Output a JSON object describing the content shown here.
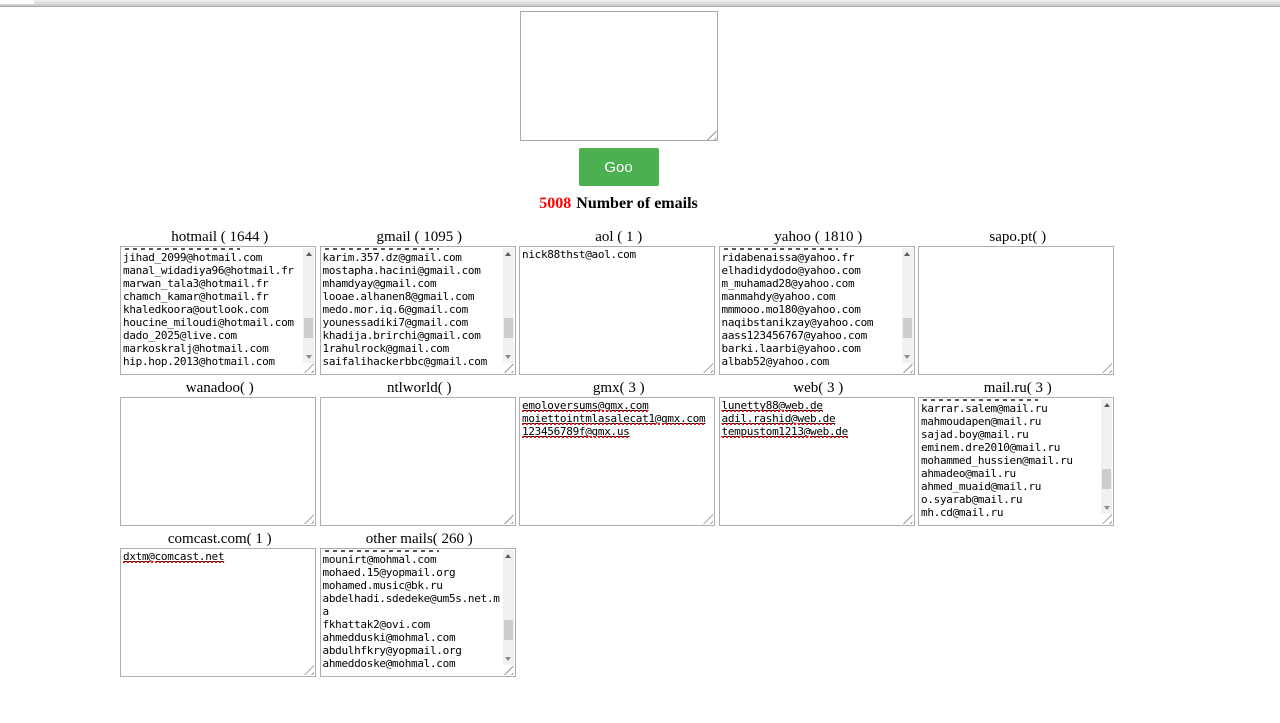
{
  "top": {
    "input_value": "",
    "button_label": "Goo",
    "count": "5008",
    "count_label": "Number of emails",
    "accent_color": "#4caf50",
    "count_color": "#ff0000"
  },
  "groups": [
    {
      "title": "hotmail ( 1644 )",
      "scrolled": true,
      "underlined": false,
      "emails": [
        "jihad_2099@hotmail.com",
        "manal_widadiya96@hotmail.fr",
        "marwan_tala3@hotmail.fr",
        "chamch_kamar@hotmail.fr",
        "khaledkoora@outlook.com",
        "houcine_miloudi@hotmail.com",
        "dado_2025@live.com",
        "markoskralj@hotmail.com",
        "hip.hop.2013@hotmail.com"
      ]
    },
    {
      "title": "gmail ( 1095 )",
      "scrolled": true,
      "underlined": false,
      "emails": [
        "karim.357.dz@gmail.com",
        "mostapha.hacini@gmail.com",
        "mhamdyay@gmail.com",
        "looae.alhanen8@gmail.com",
        "medo.mor.iq.6@gmail.com",
        "younessadiki7@gmail.com",
        "khadija.brirchi@gmail.com",
        "1rahulrock@gmail.com",
        "saifalihackerbbc@gmail.com"
      ]
    },
    {
      "title": "aol ( 1 )",
      "scrolled": false,
      "underlined": false,
      "emails": [
        "nick88thst@aol.com"
      ]
    },
    {
      "title": "yahoo ( 1810 )",
      "scrolled": true,
      "underlined": false,
      "emails": [
        "ridabenaissa@yahoo.fr",
        "elhadidydodo@yahoo.com",
        "m_muhamad28@yahoo.com",
        "manmahdy@yahoo.com",
        "mmmooo.mo180@yahoo.com",
        "naqibstanikzay@yahoo.com",
        "aass123456767@yahoo.com",
        "barki.laarbi@yahoo.com",
        "albab52@yahoo.com"
      ]
    },
    {
      "title": "sapo.pt( )",
      "scrolled": false,
      "underlined": false,
      "emails": []
    },
    {
      "title": "wanadoo( )",
      "scrolled": false,
      "underlined": false,
      "emails": []
    },
    {
      "title": "ntlworld( )",
      "scrolled": false,
      "underlined": false,
      "emails": []
    },
    {
      "title": "gmx( 3 )",
      "scrolled": false,
      "underlined": true,
      "emails": [
        "emoloversums@gmx.com",
        "moiettointmlasalecat1@gmx.com",
        "123456789f@gmx.us"
      ]
    },
    {
      "title": "web( 3 )",
      "scrolled": false,
      "underlined": true,
      "emails": [
        "lunetty88@web.de",
        "adil.rashid@web.de",
        "tempustom1213@web.de"
      ]
    },
    {
      "title": "mail.ru( 3 )",
      "scrolled": true,
      "underlined": false,
      "emails": [
        "karrar.salem@mail.ru",
        "mahmoudapen@mail.ru",
        "sajad.boy@mail.ru",
        "eminem.dre2010@mail.ru",
        "mohammed_hussien@mail.ru",
        "ahmadeo@mail.ru",
        "ahmed_muaid@mail.ru",
        "o.syarab@mail.ru",
        "mh.cd@mail.ru"
      ]
    },
    {
      "title": "comcast.com( 1 )",
      "scrolled": false,
      "underlined": true,
      "emails": [
        "dxtm@comcast.net"
      ]
    },
    {
      "title": "other mails( 260 )",
      "scrolled": true,
      "underlined": false,
      "emails": [
        "mounirt@mohmal.com",
        "mohaed.15@yopmail.org",
        "mohamed.music@bk.ru",
        "abdelhadi.sdedeke@um5s.net.ma",
        "fkhattak2@ovi.com",
        "ahmedduski@mohmal.com",
        "abdulhfkry@yopmail.org",
        "ahmeddoske@mohmal.com"
      ]
    }
  ]
}
